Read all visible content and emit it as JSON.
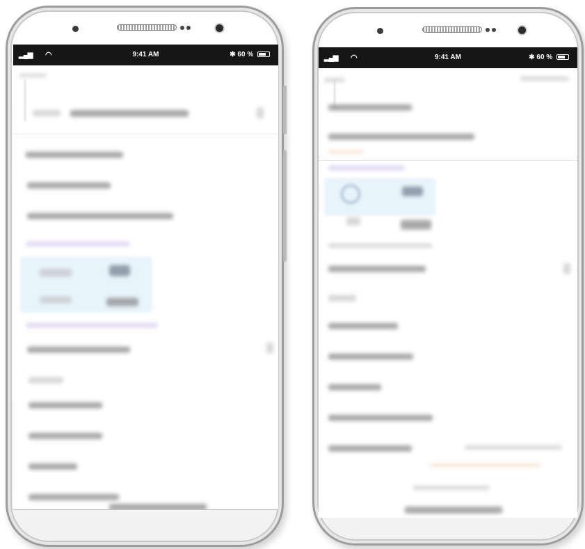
{
  "phones": [
    {
      "status_bar": {
        "signal_icon": "signal-bars-icon",
        "wifi_icon": "wifi-icon",
        "time": "9:41 AM",
        "bluetooth_icon": "bluetooth-icon",
        "battery_text": "60 %",
        "battery_icon": "battery-icon"
      }
    },
    {
      "status_bar": {
        "signal_icon": "signal-bars-icon",
        "wifi_icon": "wifi-icon",
        "time": "9:41 AM",
        "bluetooth_icon": "bluetooth-icon",
        "battery_text": "60 %",
        "battery_icon": "battery-icon"
      }
    }
  ]
}
